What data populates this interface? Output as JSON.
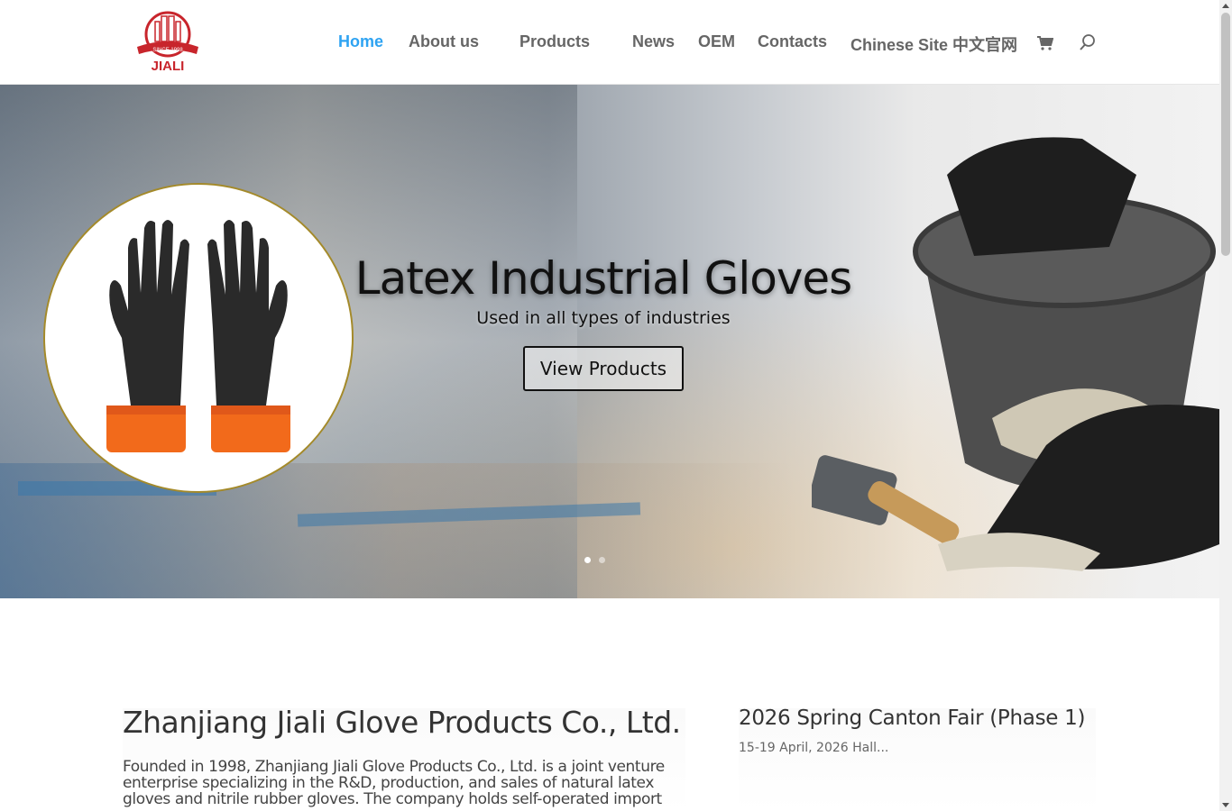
{
  "header": {
    "logo_text": "JIALI",
    "logo_since": "SINCE 1998",
    "nav": [
      {
        "label": "Home",
        "active": true
      },
      {
        "label": "About us",
        "active": false
      },
      {
        "label": "Products",
        "active": false
      },
      {
        "label": "News",
        "active": false
      },
      {
        "label": "OEM",
        "active": false
      },
      {
        "label": "Contacts",
        "active": false
      },
      {
        "label": "Chinese Site 中文官网",
        "active": false
      }
    ],
    "icons": [
      "cart-icon",
      "search-icon"
    ],
    "active_color": "#2ea3f2"
  },
  "hero": {
    "title": "Latex Industrial Gloves",
    "subtitle": "Used in all types of industries",
    "button_label": "View Products",
    "slide_count": 2,
    "active_slide": 1
  },
  "company": {
    "title": "Zhanjiang Jiali Glove Products Co., Ltd.",
    "description": "Founded in 1998, Zhanjiang Jiali Glove Products Co., Ltd. is a joint venture enterprise specializing in the R&D, production, and sales of natural latex gloves and nitrile rubber gloves. The company holds self-operated import"
  },
  "news": {
    "title": "2026 Spring Canton Fair (Phase 1)",
    "excerpt": "15-19 April, 2026 Hall..."
  }
}
